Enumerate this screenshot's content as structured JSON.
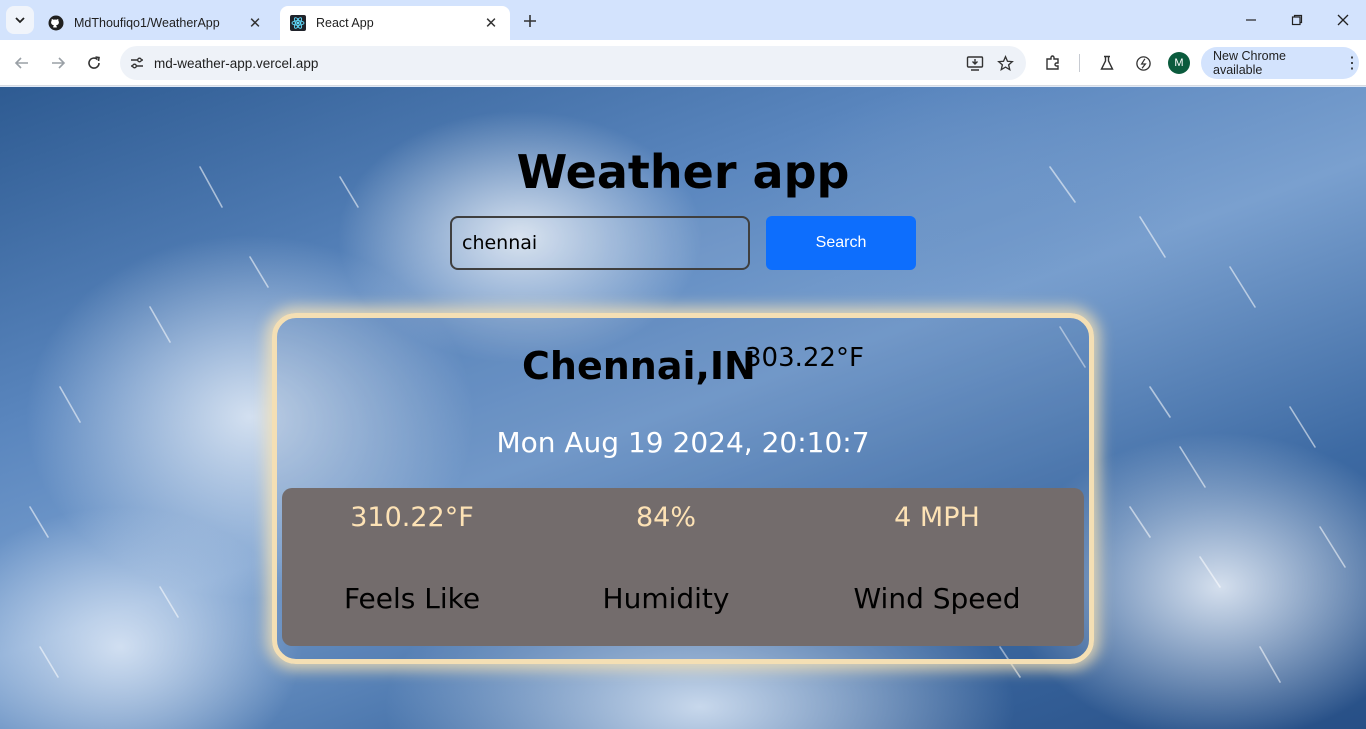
{
  "browser": {
    "tabs": [
      {
        "title": "MdThoufiqo1/WeatherApp",
        "active": false,
        "icon": "github-icon"
      },
      {
        "title": "React App",
        "active": true,
        "icon": "react-icon"
      }
    ],
    "url": "md-weather-app.vercel.app",
    "profile_initial": "M",
    "update_label": "New Chrome available",
    "colors": {
      "tabstrip": "#d3e3fd",
      "avatar": "#0b5b3d"
    }
  },
  "app": {
    "title": "Weather app",
    "search": {
      "value": "chennai",
      "button_label": "Search"
    },
    "weather": {
      "city": "Chennai,IN",
      "temperature": "303.22°F",
      "datetime": "Mon Aug 19 2024, 20:10:7",
      "stats": [
        {
          "value": "310.22°F",
          "label": "Feels Like"
        },
        {
          "value": "84%",
          "label": "Humidity"
        },
        {
          "value": "4 MPH",
          "label": "Wind Speed"
        }
      ]
    },
    "colors": {
      "button": "#0d6efd",
      "stats_panel": "#736c6c",
      "stat_value": "#fde2b5",
      "card_border": "#f4dfb4"
    }
  }
}
